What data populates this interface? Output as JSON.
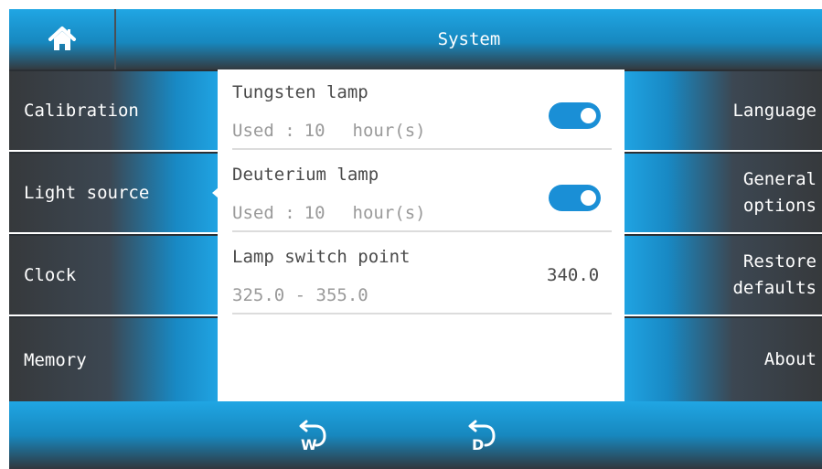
{
  "header": {
    "title": "System",
    "home_icon": "home-icon"
  },
  "left_menu": [
    {
      "label": "Calibration",
      "active": false
    },
    {
      "label": "Light source",
      "active": true
    },
    {
      "label": "Clock",
      "active": false
    },
    {
      "label": "Memory",
      "active": false
    }
  ],
  "right_menu": [
    {
      "line1": "Language",
      "line2": ""
    },
    {
      "line1": "General",
      "line2": "options"
    },
    {
      "line1": "Restore",
      "line2": "defaults"
    },
    {
      "line1": "About",
      "line2": ""
    }
  ],
  "settings": {
    "tungsten": {
      "title": "Tungsten lamp",
      "used_label": "Used :",
      "used_value": "10",
      "unit": "hour(s)",
      "enabled": true
    },
    "deuterium": {
      "title": "Deuterium lamp",
      "used_label": "Used :",
      "used_value": "10",
      "unit": "hour(s)",
      "enabled": true
    },
    "switch_point": {
      "title": "Lamp switch point",
      "range": "325.0 - 355.0",
      "value": "340.0"
    }
  },
  "footer": {
    "buttons": [
      {
        "letter": "W",
        "icon": "rotate-w-icon"
      },
      {
        "letter": "D",
        "icon": "rotate-d-icon"
      }
    ]
  },
  "colors": {
    "accent": "#1a8fd6",
    "dark": "#36393c",
    "bar_blue": "#20a6e4"
  }
}
